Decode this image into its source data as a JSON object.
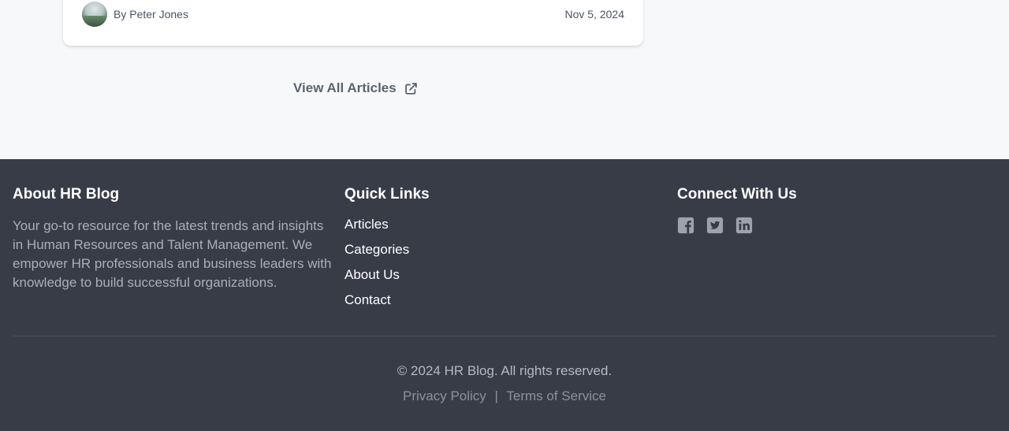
{
  "article": {
    "author": "By Peter Jones",
    "date": "Nov 5, 2024"
  },
  "view_all": {
    "label": "View All Articles",
    "icon": "external-link-icon"
  },
  "footer": {
    "about": {
      "title": "About HR Blog",
      "text": "Your go-to resource for the latest trends and insights in Human Resources and Talent Management. We empower HR professionals and business leaders with knowledge to build successful organizations."
    },
    "quick_links": {
      "title": "Quick Links",
      "items": [
        "Articles",
        "Categories",
        "About Us",
        "Contact"
      ]
    },
    "connect": {
      "title": "Connect With Us",
      "icons": [
        "facebook-icon",
        "twitter-icon",
        "linkedin-icon"
      ]
    },
    "copyright": "© 2024 HR Blog. All rights reserved.",
    "legal": {
      "privacy": "Privacy Policy",
      "separator": "|",
      "terms": "Terms of Service"
    }
  },
  "colors": {
    "footer_bg": "#373c47",
    "page_bg": "#f7f8fa",
    "icon_gray": "#9ca3af"
  }
}
